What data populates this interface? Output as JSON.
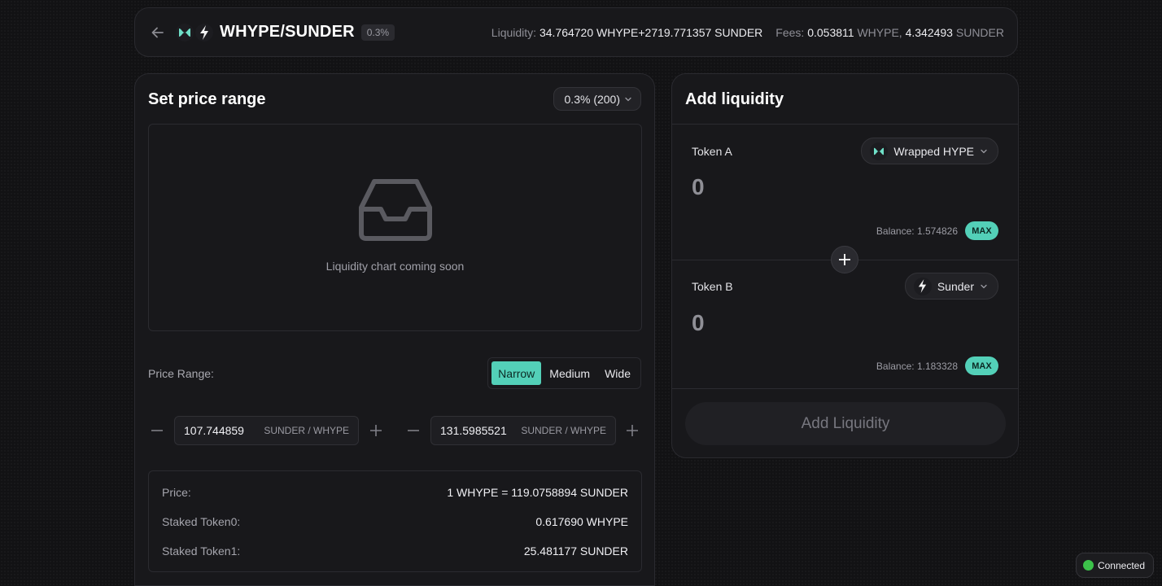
{
  "header": {
    "pair": "WHYPE/SUNDER",
    "fee_tier": "0.3%",
    "liquidity_label": "Liquidity:",
    "liquidity_value": "34.764720 WHYPE+2719.771357 SUNDER",
    "fees_label": "Fees:",
    "fees_a_amount": "0.053811",
    "fees_a_symbol": "WHYPE,",
    "fees_b_amount": "4.342493",
    "fees_b_symbol": "SUNDER"
  },
  "range_panel": {
    "title": "Set price range",
    "fee_select": "0.3% (200)",
    "chart_message": "Liquidity chart coming soon",
    "price_range_label": "Price Range:",
    "range_options": [
      "Narrow",
      "Medium",
      "Wide"
    ],
    "active_range": "Narrow",
    "min_price": {
      "value": "107.744859",
      "unit": "SUNDER / WHYPE"
    },
    "max_price": {
      "value": "131.5985521",
      "unit": "SUNDER / WHYPE"
    },
    "info": [
      {
        "label": "Price:",
        "value": "1 WHYPE = 119.0758894 SUNDER"
      },
      {
        "label": "Staked Token0:",
        "value": "0.617690 WHYPE"
      },
      {
        "label": "Staked Token1:",
        "value": "25.481177 SUNDER"
      }
    ]
  },
  "liquidity_panel": {
    "title": "Add liquidity",
    "token_a": {
      "label": "Token A",
      "token": "Wrapped HYPE",
      "amount": "0",
      "balance": "Balance: 1.574826",
      "max": "MAX"
    },
    "token_b": {
      "label": "Token B",
      "token": "Sunder",
      "amount": "0",
      "balance": "Balance: 1.183328",
      "max": "MAX"
    },
    "submit_label": "Add Liquidity"
  },
  "status": {
    "label": "Connected",
    "color": "#3cc24a"
  },
  "colors": {
    "accent": "#53d0b8",
    "background": "#121214",
    "panel": "#18181b"
  }
}
